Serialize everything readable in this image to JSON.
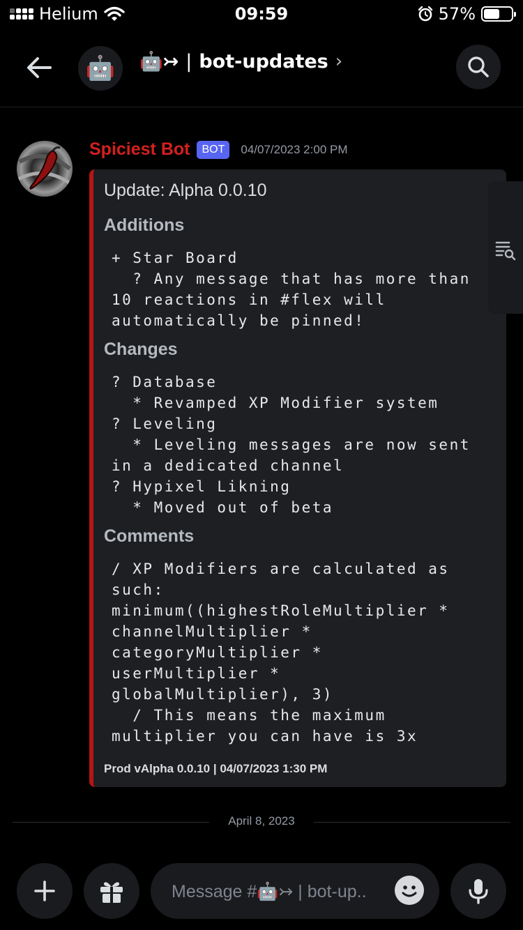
{
  "status_bar": {
    "carrier": "Helium",
    "time": "09:59",
    "battery_percent": "57%",
    "battery_level": 0.57
  },
  "header": {
    "server_emoji": "🤖",
    "channel_emoji": "🤖↣",
    "channel_separator": "|",
    "channel_name": "bot-updates",
    "chevron": "›"
  },
  "message": {
    "author": "Spiciest Bot",
    "badge": "BOT",
    "timestamp": "04/07/2023 2:00 PM",
    "embed": {
      "title": "Update: Alpha 0.0.10",
      "fields": [
        {
          "name": "Additions",
          "lines": [
            "+ Star Board",
            "  ? Any message that has more than",
            "10 reactions in #flex will",
            "automatically be pinned!"
          ]
        },
        {
          "name": "Changes",
          "lines": [
            "? Database",
            "  * Revamped XP Modifier system",
            "? Leveling",
            "  * Leveling messages are now sent",
            "in a dedicated channel",
            "? Hypixel Likning",
            "  * Moved out of beta"
          ]
        },
        {
          "name": "Comments",
          "lines": [
            "/ XP Modifiers are calculated as",
            "such:",
            "minimum((highestRoleMultiplier *",
            "channelMultiplier *",
            "categoryMultiplier *",
            "userMultiplier *",
            "globalMultiplier), 3)",
            "  / This means the maximum",
            "multiplier you can have is 3x"
          ]
        }
      ],
      "footer": "Prod vAlpha 0.0.10 | 04/07/2023 1:30 PM"
    }
  },
  "date_divider": "April 8, 2023",
  "composer": {
    "placeholder": "Message #🤖↣ | bot-up.."
  },
  "colors": {
    "author": "#d4201d",
    "embed_border": "#b61515",
    "bot_badge": "#5865f2",
    "background": "#000000",
    "surface": "#1a1b1e"
  },
  "icons": [
    "back-arrow-icon",
    "search-icon",
    "threads-search-icon",
    "plus-icon",
    "gift-icon",
    "emoji-icon",
    "microphone-icon"
  ]
}
